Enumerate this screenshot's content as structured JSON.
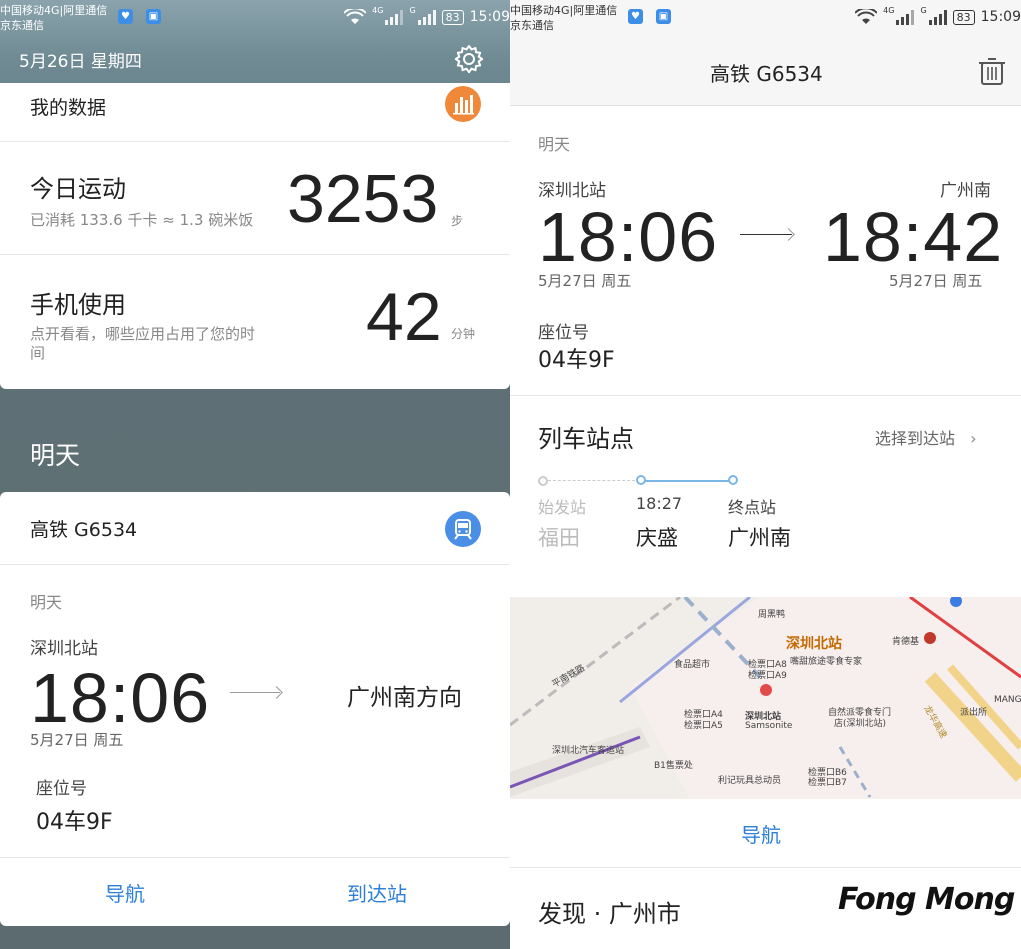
{
  "status_left": {
    "carrier_line1": "中国移动4G|阿里通信",
    "carrier_line2": "京东通信",
    "net1": "4G",
    "net2": "G",
    "battery": "83",
    "time": "15:09"
  },
  "status_right": {
    "carrier_line1": "中国移动4G|阿里通信",
    "carrier_line2": "京东通信",
    "net1": "4G",
    "net2": "G",
    "battery": "83",
    "time": "15:09"
  },
  "left": {
    "date": "5月26日 星期四",
    "my_data": {
      "title": "我的数据"
    },
    "exercise": {
      "title": "今日运动",
      "sub": "已消耗 133.6 千卡 ≈ 1.3 碗米饭",
      "value": "3253",
      "unit": "步"
    },
    "phone_usage": {
      "title": "手机使用",
      "sub_line1": "点开看看，哪些应用占用了您的时",
      "sub_line2": "间",
      "value": "42",
      "unit": "分钟"
    },
    "tomorrow_header": "明天",
    "train_card": {
      "title": "高铁  G6534",
      "day": "明天",
      "from_station": "深圳北站",
      "depart_time": "18:06",
      "direction": "广州南方向",
      "date": "5月27日 周五",
      "seat_label": "座位号",
      "seat": "04车9F",
      "nav_button": "导航",
      "arrive_button": "到达站"
    }
  },
  "right": {
    "title": "高铁 G6534",
    "day": "明天",
    "from_station": "深圳北站",
    "to_station": "广州南",
    "depart_time": "18:06",
    "arrive_time": "18:42",
    "depart_date": "5月27日 周五",
    "arrive_date": "5月27日 周五",
    "seat_label": "座位号",
    "seat": "04车9F",
    "stops_title": "列车站点",
    "choose_station": "选择到达站",
    "stops": [
      {
        "label": "始发站",
        "name": "福田",
        "past": true
      },
      {
        "label": "18:27",
        "name": "庆盛",
        "past": false
      },
      {
        "label": "终点站",
        "name": "广州南",
        "past": false
      }
    ],
    "map_labels": {
      "station": "深圳北站",
      "road1": "平南铁路",
      "zhoujiya": "周黑鸭",
      "food": "食品超市",
      "gate_a8": "检票口A8",
      "gate_a9": "检票口A9",
      "snack": "嘴甜旅途零食专家",
      "kfc": "肯德基",
      "gate_a4": "检票口A4",
      "gate_a5": "检票口A5",
      "station_pin": "深圳北站",
      "samsonite": "Samsonite",
      "zizhu": "自然派零食专门",
      "zizhu2": "店(深圳北站)",
      "bus": "深圳北汽车客运站",
      "b1": "B1售票处",
      "toys": "利记玩具总动员",
      "gate_b6": "检票口B6",
      "gate_b7": "检票口B7",
      "police": "派出所",
      "mang": "MANG",
      "road2": "龙华高速"
    },
    "nav_button": "导航",
    "discover": "发现 · 广州市",
    "watermark": "Fong Mong"
  }
}
